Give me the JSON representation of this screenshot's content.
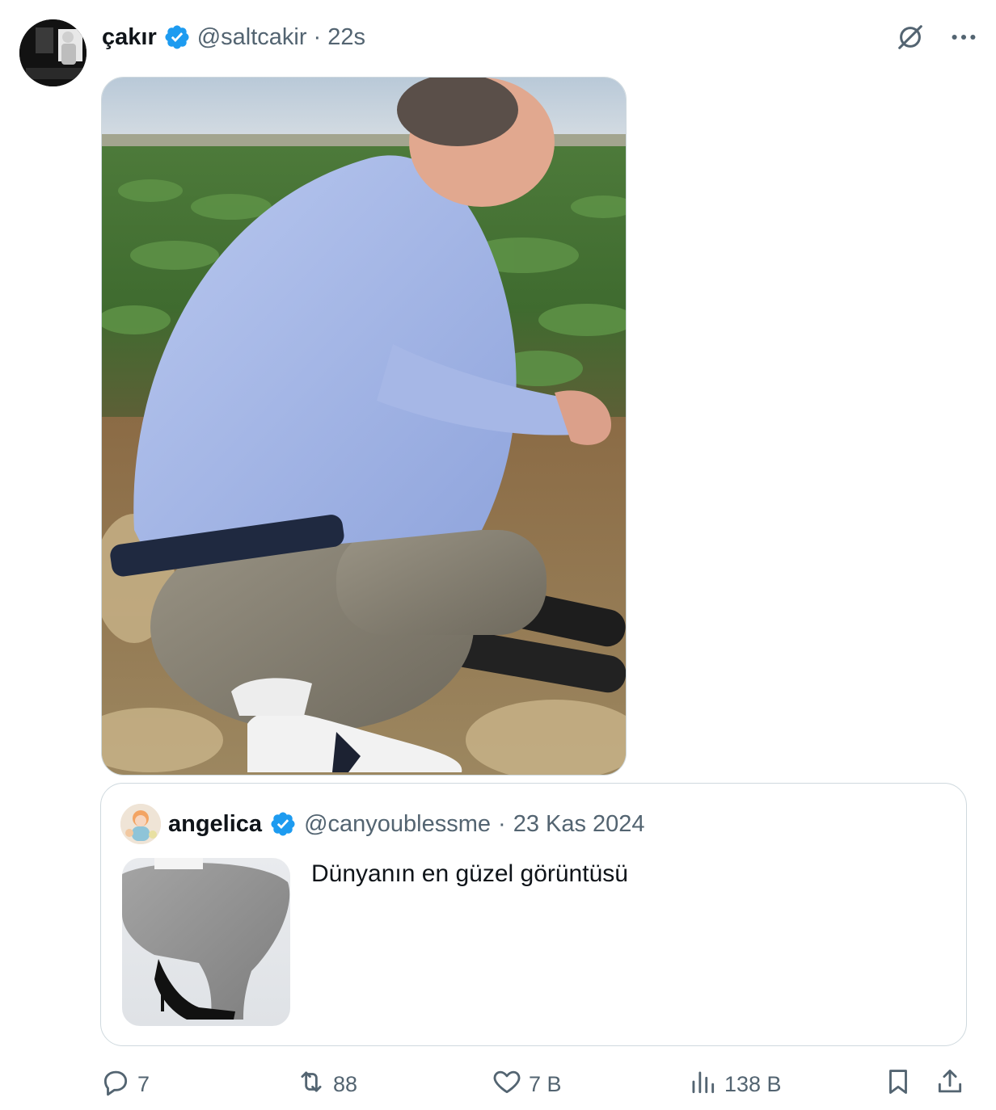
{
  "author": {
    "display_name": "çakır",
    "handle": "@saltcakir",
    "separator": "·",
    "timestamp": "22s",
    "avatar_icon": "avatar-photo"
  },
  "top_actions": [
    {
      "name": "grok-icon"
    },
    {
      "name": "more-icon"
    }
  ],
  "media": {
    "description_icon": "photo-man-squatting-in-field"
  },
  "quoted_tweet": {
    "display_name": "angelica",
    "handle": "@canyoublessme",
    "separator": "·",
    "date": "23 Kas 2024",
    "text": "Dünyanın en güzel görüntüsü",
    "media_icon": "photo-woman-squatting-heels"
  },
  "actions": {
    "replies": "7",
    "reposts": "88",
    "likes": "7 B",
    "views": "138 B"
  },
  "colors": {
    "accent": "#1d9bf0",
    "secondary_text": "#536471",
    "border": "#cfd9de"
  }
}
